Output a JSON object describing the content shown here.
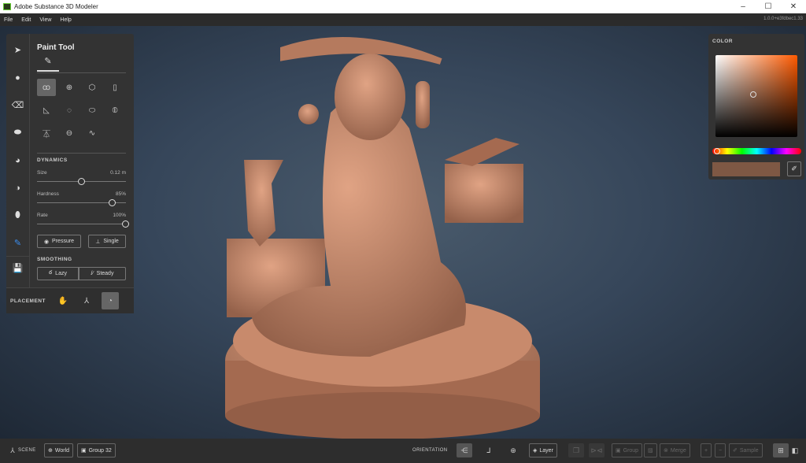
{
  "window": {
    "title": "Adobe Substance 3D Modeler",
    "minimize": "–",
    "maximize": "☐",
    "close": "✕",
    "version": "1.0.0+e3fdbec1.33"
  },
  "menu": [
    "File",
    "Edit",
    "View",
    "Help"
  ],
  "left_panel": {
    "tools": [
      "select",
      "clay",
      "erase",
      "smooth",
      "stamp",
      "symmetry",
      "inflate",
      "paint",
      "save"
    ],
    "active_tool": "paint",
    "title": "Paint Tool",
    "brush_icons": [
      "stroke",
      "sphere",
      "cube",
      "cylinder",
      "cone",
      "blob",
      "capsule",
      "ellipsoid",
      "pin",
      "disc",
      "curve"
    ],
    "dynamics": {
      "label": "DYNAMICS",
      "size": {
        "label": "Size",
        "value": "0.12 m",
        "fraction": 0.5
      },
      "hardness": {
        "label": "Hardness",
        "value": "85%",
        "fraction": 0.85
      },
      "rate": {
        "label": "Rate",
        "value": "100%",
        "fraction": 1.0
      },
      "pressure": "Pressure",
      "single": "Single"
    },
    "smoothing": {
      "label": "SMOOTHING",
      "lazy": "Lazy",
      "steady": "Steady"
    },
    "placement": {
      "label": "PLACEMENT",
      "active": "surface"
    }
  },
  "color_panel": {
    "label": "COLOR",
    "color": "#7e5844",
    "hue": "#ff5a00"
  },
  "bottom": {
    "scene": "SCENE",
    "world": "World",
    "group": "Group 32",
    "orientation": "ORIENTATION",
    "layer": "Layer",
    "group_btn": "Group",
    "merge": "Merge",
    "plus": "+",
    "minus": "−",
    "sample": "Sample"
  }
}
